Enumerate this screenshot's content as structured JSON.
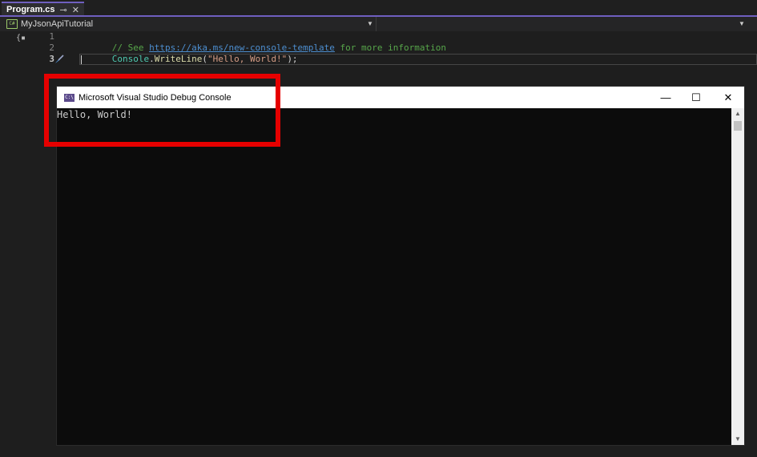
{
  "tab": {
    "filename": "Program.cs",
    "pin_glyph": "⊸",
    "close_glyph": "✕"
  },
  "navbar": {
    "project_icon_text": "C#",
    "project_name": "MyJsonApiTutorial"
  },
  "editor": {
    "lines": [
      {
        "number": "1"
      },
      {
        "number": "2"
      },
      {
        "number": "3"
      }
    ],
    "line1": {
      "comment_prefix": "// See ",
      "link": "https://aka.ms/new-console-template",
      "comment_suffix": " for more information"
    },
    "line2": {
      "class": "Console",
      "dot": ".",
      "method": "WriteLine",
      "open": "(",
      "string": "\"Hello, World!\"",
      "close": ");"
    }
  },
  "console": {
    "app_icon_text": "C:\\",
    "title": "Microsoft Visual Studio Debug Console",
    "minimize": "—",
    "maximize": "☐",
    "close": "✕",
    "output": "Hello, World!",
    "scroll_up": "▲",
    "scroll_down": "▼"
  },
  "colors": {
    "accent": "#6f5fbf",
    "comment": "#57a64a",
    "link": "#4d8fd1",
    "class": "#4ec9b0",
    "method": "#dcdcaa",
    "string": "#d69d85",
    "highlight": "#e60000"
  }
}
